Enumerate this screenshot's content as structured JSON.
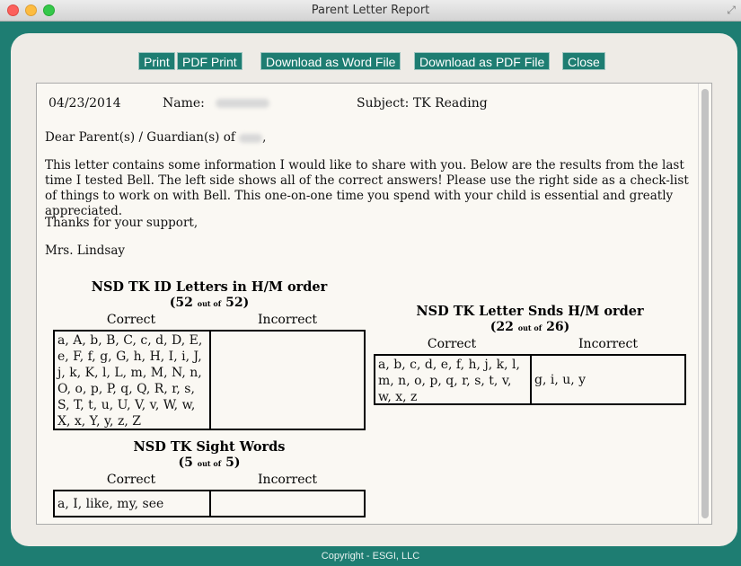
{
  "window": {
    "title": "Parent Letter Report"
  },
  "toolbar": {
    "print": "Print",
    "pdf_print": "PDF Print",
    "download_word": "Download as Word File",
    "download_pdf": "Download as PDF File",
    "close": "Close"
  },
  "report": {
    "date": "04/23/2014",
    "name_label": "Name:",
    "subject": "Subject: TK Reading",
    "greeting": "Dear Parent(s) / Guardian(s) of",
    "greeting_suffix": ",",
    "body": "This letter contains some information I would like to share with you. Below are the results from the last time I tested Bell. The left side shows all of the correct answers! Please use the right side as a check-list of things to work on with Bell. This one-on-one time you spend with your child is essential and greatly appreciated.",
    "thanks": "Thanks for your support,",
    "signature": "Mrs. Lindsay"
  },
  "tables": {
    "letters": {
      "title": "NSD TK ID Letters in H/M order",
      "score": "52",
      "out_of": "out of",
      "total": "52",
      "correct_label": "Correct",
      "incorrect_label": "Incorrect",
      "correct": "a, A, b, B, C, c, d, D, E, e, F, f, g, G, h, H, I, i, J, j, k, K, l, L, m, M, N, n, O, o, p, P, q, Q, R, r, s, S, T, t, u, U, V, v, W, w, X, x, Y, y, z, Z",
      "incorrect": ""
    },
    "sounds": {
      "title": "NSD TK Letter Snds H/M order",
      "score": "22",
      "out_of": "out of",
      "total": "26",
      "correct_label": "Correct",
      "incorrect_label": "Incorrect",
      "correct": "a, b, c, d, e, f, h, j, k, l, m, n, o, p, q, r, s, t, v, w, x, z",
      "incorrect": "g, i, u, y"
    },
    "sight": {
      "title": "NSD TK Sight Words",
      "score": "5",
      "out_of": "out of",
      "total": "5",
      "correct_label": "Correct",
      "incorrect_label": "Incorrect",
      "correct": "a, I, like, my, see",
      "incorrect": ""
    }
  },
  "footer": {
    "copyright": "Copyright - ESGI, LLC"
  }
}
